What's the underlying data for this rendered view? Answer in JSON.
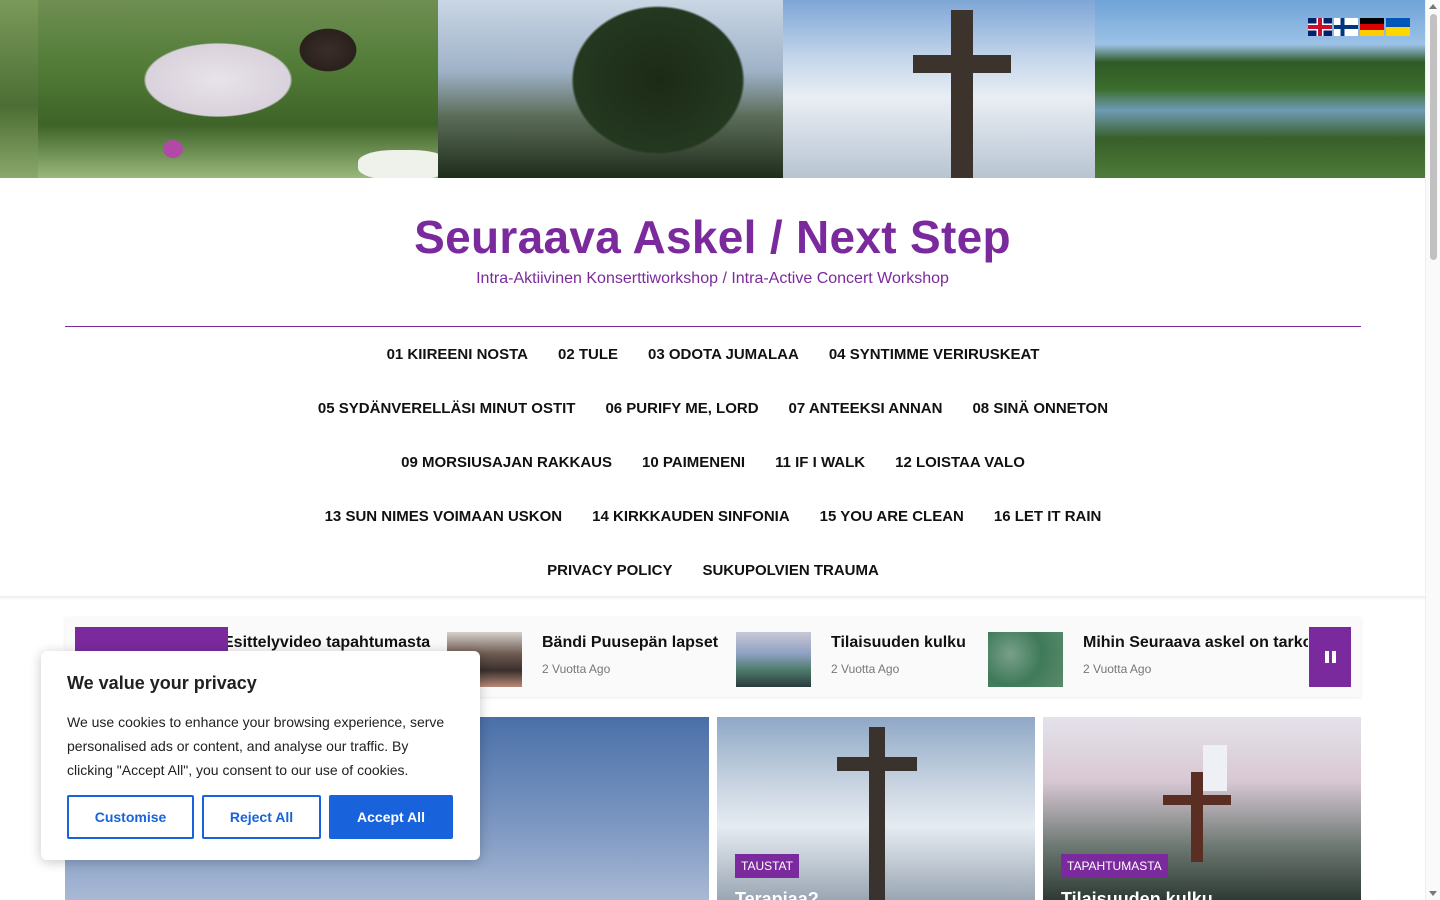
{
  "site": {
    "title": "Seuraava Askel / Next Step",
    "tagline": "Intra-Aktiivinen Konserttiworkshop / Intra-Active Concert Workshop"
  },
  "languages": [
    {
      "icon": "uk-flag-icon"
    },
    {
      "icon": "finland-flag-icon"
    },
    {
      "icon": "germany-flag-icon"
    },
    {
      "icon": "ukraine-flag-icon"
    }
  ],
  "nav": {
    "rows": [
      [
        "01 KIIREENI NOSTA",
        "02 TULE",
        "03 ODOTA JUMALAA",
        "04 SYNTIMME VERIRUSKEAT"
      ],
      [
        "05 SYDÄNVERELLÄSI MINUT OSTIT",
        "06 PURIFY ME, LORD",
        "07 ANTEEKSI ANNAN",
        "08 SINÄ ONNETON"
      ],
      [
        "09 MORSIUSAJAN RAKKAUS",
        "10 PAIMENENI",
        "11 IF I WALK",
        "12 LOISTAA VALO"
      ],
      [
        "13 SUN NIMES VOIMAAN USKON",
        "14 KIRKKAUDEN SINFONIA",
        "15 YOU ARE CLEAN",
        "16 LET IT RAIN"
      ],
      [
        "PRIVACY POLICY",
        "SUKUPOLVIEN TRAUMA"
      ]
    ]
  },
  "ticker": {
    "items": [
      {
        "title": "Esittelyvideo tapahtumasta",
        "date": ""
      },
      {
        "title": "Bändi Puusepän lapset",
        "date": "2 Vuotta Ago"
      },
      {
        "title": "Tilaisuuden kulku",
        "date": "2 Vuotta Ago"
      },
      {
        "title": "Mihin Seuraava askel on tarkoitettu",
        "date": "2 Vuotta Ago"
      }
    ]
  },
  "cards": [
    {
      "category": "",
      "title": ""
    },
    {
      "category": "TAUSTAT",
      "title": "Terapiaa?"
    },
    {
      "category": "TAPAHTUMASTA",
      "title": "Tilaisuuden kulku"
    }
  ],
  "cookie": {
    "title": "We value your privacy",
    "text": "We use cookies to enhance your browsing experience, serve personalised ads or content, and analyse our traffic. By clicking \"Accept All\", you consent to our use of cookies.",
    "customise": "Customise",
    "reject": "Reject All",
    "accept": "Accept All"
  },
  "colors": {
    "brand_purple": "#7b2a9d",
    "cookie_blue": "#1863dc"
  }
}
